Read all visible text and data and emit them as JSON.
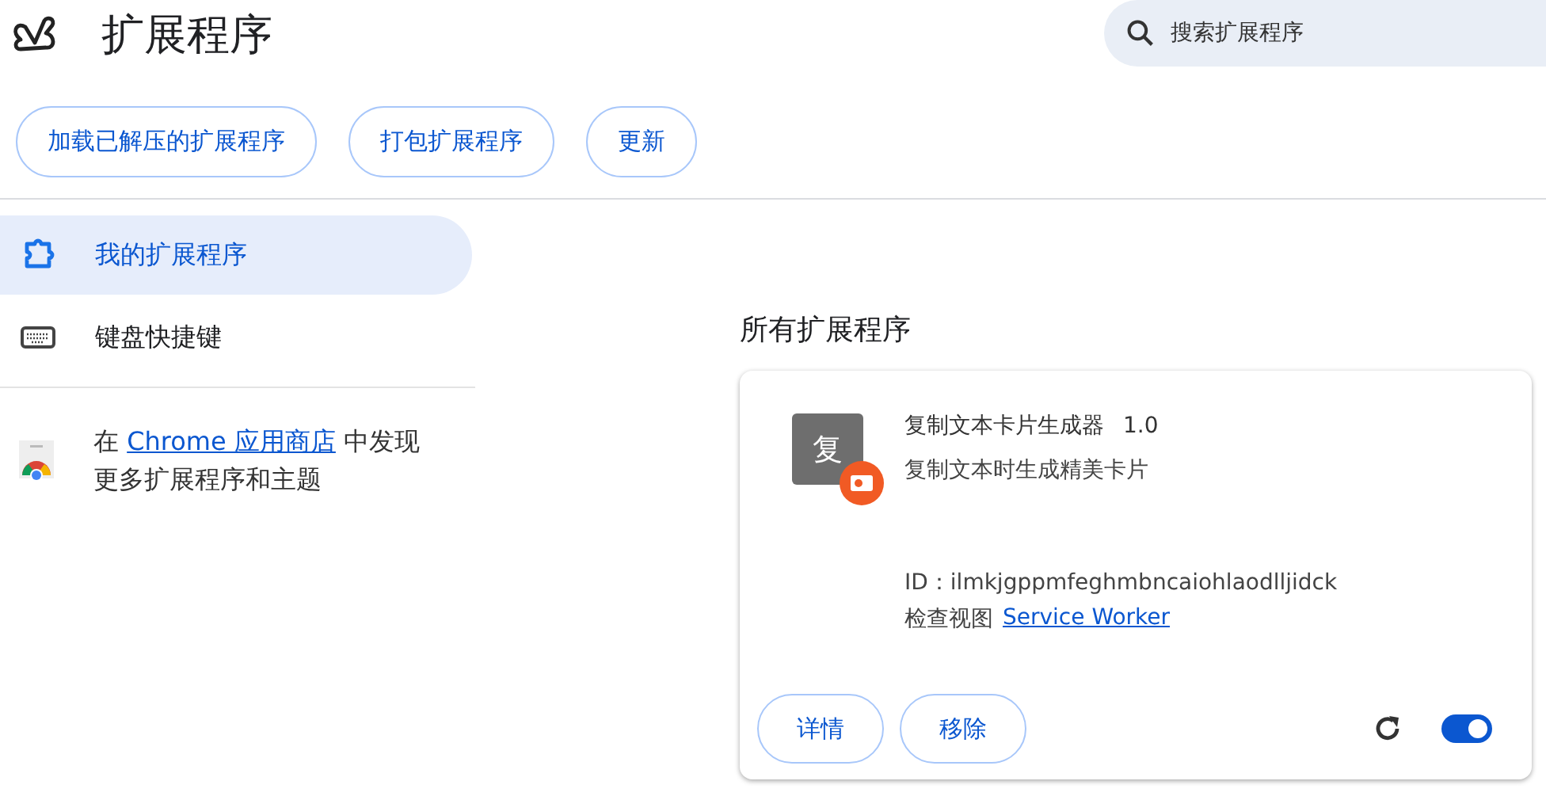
{
  "header": {
    "title": "扩展程序",
    "search": {
      "placeholder": "搜索扩展程序"
    }
  },
  "toolbar": {
    "buttons": [
      "加载已解压的扩展程序",
      "打包扩展程序",
      "更新"
    ]
  },
  "sidebar": {
    "items": [
      {
        "label": "我的扩展程序",
        "kind": "puzzle",
        "selected": true
      },
      {
        "label": "键盘快捷键",
        "kind": "keyboard",
        "selected": false
      }
    ],
    "store_promo": {
      "before": "在",
      "link": "Chrome 应用商店",
      "after": "中发现更多扩展程序和主题"
    }
  },
  "main": {
    "heading": "所有扩展程序",
    "extensions": [
      {
        "icon_text": "复",
        "name": "复制文本卡片生成器",
        "version": "1.0",
        "description": "复制文本时生成精美卡片",
        "id": "ID：ilmkjgppmfeghmbncaiohlaodlljidck",
        "inspect_label": "检查视图",
        "inspect_link": "Service Worker",
        "buttons": [
          "详情",
          "移除"
        ],
        "enabled": true
      }
    ]
  }
}
